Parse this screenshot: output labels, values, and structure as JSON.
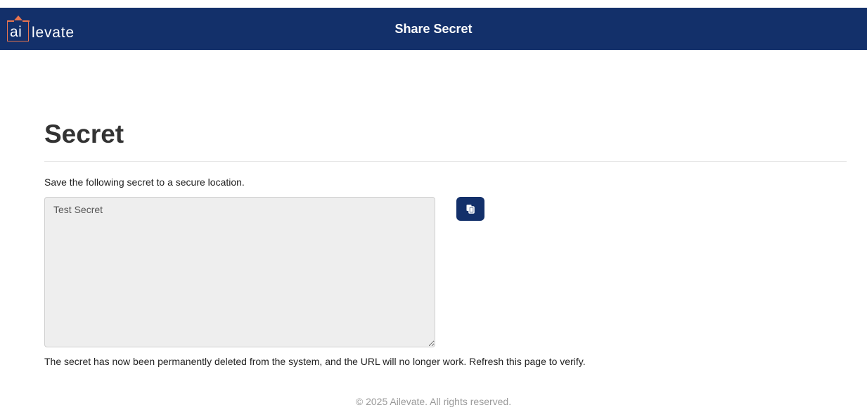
{
  "header": {
    "logo": {
      "ai": "ai",
      "rest": "levate"
    },
    "title": "Share Secret"
  },
  "main": {
    "heading": "Secret",
    "instruction": "Save the following secret to a secure location.",
    "secret_value": "Test Secret",
    "copy_icon": "copy-icon",
    "notice": "The secret has now been permanently deleted from the system, and the URL will no longer work. Refresh this page to verify."
  },
  "footer": {
    "text": "© 2025 Ailevate. All rights reserved."
  },
  "colors": {
    "header_bg": "#13306a",
    "logo_accent": "#e8744f",
    "button_bg": "#13306a",
    "textarea_bg": "#eeeeee"
  }
}
